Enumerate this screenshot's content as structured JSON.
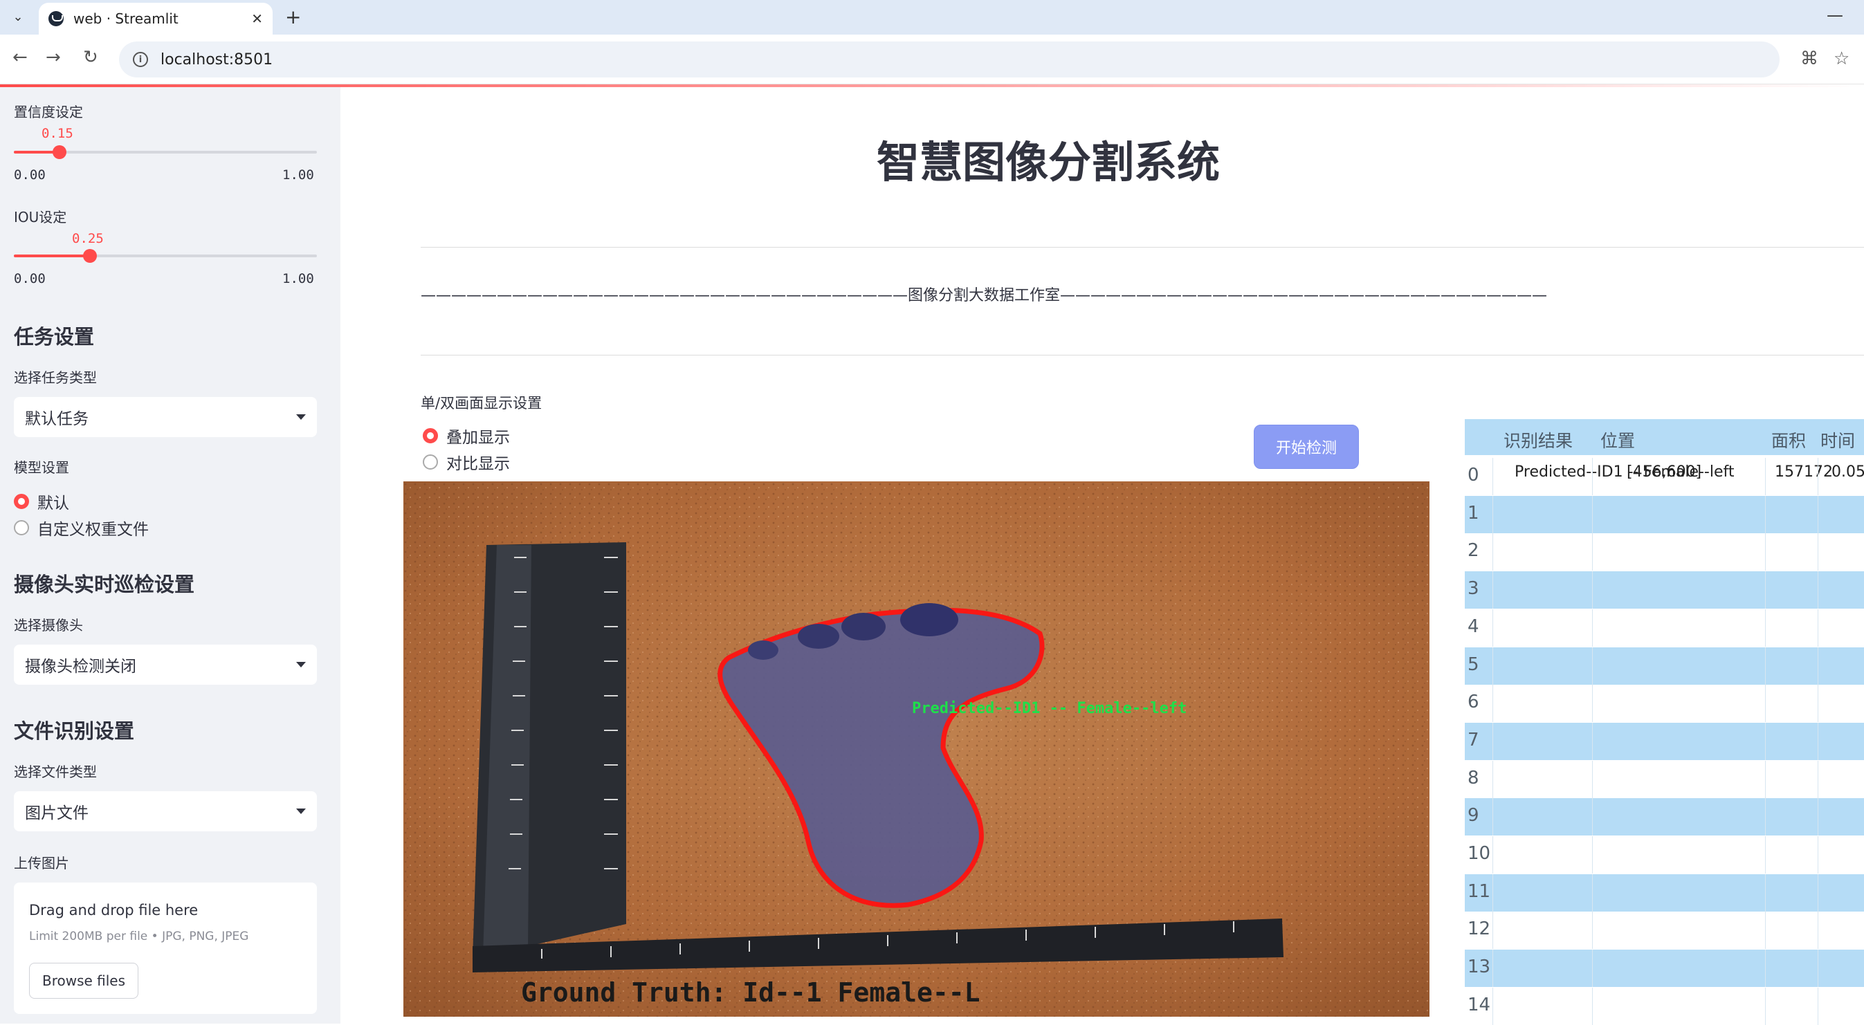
{
  "browser": {
    "tab_title": "web · Streamlit",
    "url": "localhost:8501"
  },
  "sidebar": {
    "confidence": {
      "label": "置信度设定",
      "value": "0.15",
      "min": "0.00",
      "max": "1.00",
      "fraction": 0.15
    },
    "iou": {
      "label": "IOU设定",
      "value": "0.25",
      "min": "0.00",
      "max": "1.00",
      "fraction": 0.25
    },
    "task_header": "任务设置",
    "task_type_label": "选择任务类型",
    "task_type_value": "默认任务",
    "model_label": "模型设置",
    "model_options": [
      "默认",
      "自定义权重文件"
    ],
    "model_selected": 0,
    "camera_header": "摄像头实时巡检设置",
    "camera_label": "选择摄像头",
    "camera_value": "摄像头检测关闭",
    "file_header": "文件识别设置",
    "file_type_label": "选择文件类型",
    "file_type_value": "图片文件",
    "upload_label": "上传图片",
    "upload_title": "Drag and drop file here",
    "upload_limit": "Limit 200MB per file • JPG, PNG, JPEG",
    "browse_label": "Browse files"
  },
  "main": {
    "title": "智慧图像分割系统",
    "studio": "————————————————————————————————图像分割大数据工作室————————————————————————————————",
    "display_label": "单/双画面显示设置",
    "display_options": [
      "叠加显示",
      "对比显示"
    ],
    "display_selected": 0,
    "start_button": "开始检测",
    "image_overlay_label": "Predicted--ID1 -- Female--left",
    "image_caption": "Ground Truth: Id--1 Female--L"
  },
  "table": {
    "headers": [
      "识别结果",
      "位置",
      "面积",
      "时间"
    ],
    "rows": [
      {
        "idx": "0",
        "result": "Predicted--ID1 -- Female--left",
        "position": "[456,600]",
        "area": "157172",
        "time": "0.05"
      },
      {
        "idx": "1"
      },
      {
        "idx": "2"
      },
      {
        "idx": "3"
      },
      {
        "idx": "4"
      },
      {
        "idx": "5"
      },
      {
        "idx": "6"
      },
      {
        "idx": "7"
      },
      {
        "idx": "8"
      },
      {
        "idx": "9"
      },
      {
        "idx": "10"
      },
      {
        "idx": "11"
      },
      {
        "idx": "12"
      },
      {
        "idx": "13"
      },
      {
        "idx": "14"
      }
    ]
  },
  "colors": {
    "accent": "#ff4b4b",
    "button": "#8b9cf4",
    "table_stripe": "#b5dcf6",
    "sidebar_bg": "#f0f2f6"
  }
}
